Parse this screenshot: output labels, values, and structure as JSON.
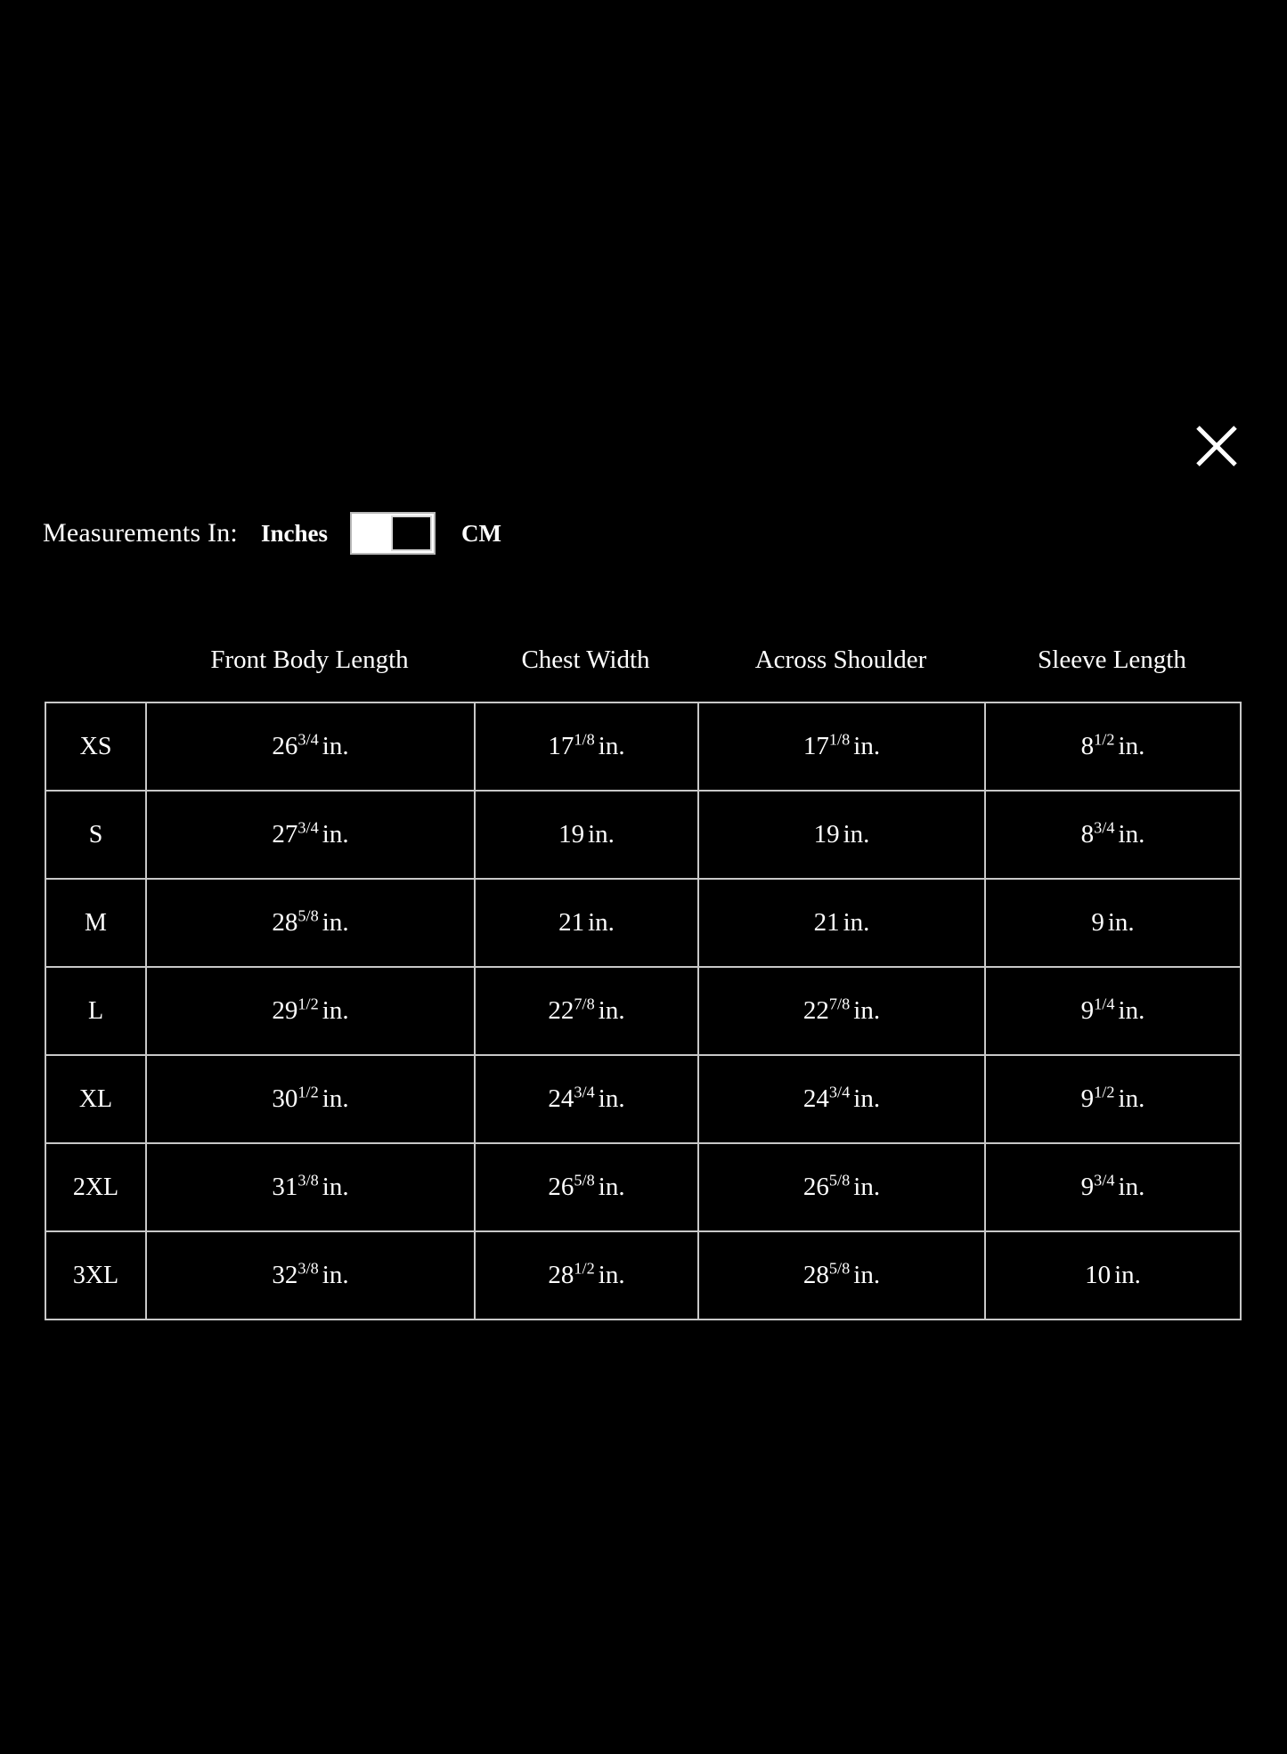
{
  "dialog": {
    "close_label": "Close",
    "close_icon": "close-x-icon"
  },
  "units": {
    "label": "Measurements In:",
    "option_left": "Inches",
    "option_right": "CM",
    "selected": "Inches",
    "toggle_state": "left",
    "track_color": "#ffffff",
    "knob_color": "#000000",
    "border_color": "#b9b9b9"
  },
  "table": {
    "size_column_header": "",
    "headers": [
      "Front Body Length",
      "Chest Width",
      "Across Shoulder",
      "Sleeve Length"
    ],
    "unit_suffix": "in.",
    "border_color": "#c8c8c8",
    "rows": [
      {
        "size": "XS",
        "cells": [
          {
            "whole": "26",
            "fraction": "3/4",
            "unit": "in."
          },
          {
            "whole": "17",
            "fraction": "1/8",
            "unit": "in."
          },
          {
            "whole": "17",
            "fraction": "1/8",
            "unit": "in."
          },
          {
            "whole": "8",
            "fraction": "1/2",
            "unit": "in."
          }
        ]
      },
      {
        "size": "S",
        "cells": [
          {
            "whole": "27",
            "fraction": "3/4",
            "unit": "in."
          },
          {
            "whole": "19",
            "fraction": "",
            "unit": "in."
          },
          {
            "whole": "19",
            "fraction": "",
            "unit": "in."
          },
          {
            "whole": "8",
            "fraction": "3/4",
            "unit": "in."
          }
        ]
      },
      {
        "size": "M",
        "cells": [
          {
            "whole": "28",
            "fraction": "5/8",
            "unit": "in."
          },
          {
            "whole": "21",
            "fraction": "",
            "unit": "in."
          },
          {
            "whole": "21",
            "fraction": "",
            "unit": "in."
          },
          {
            "whole": "9",
            "fraction": "",
            "unit": "in."
          }
        ]
      },
      {
        "size": "L",
        "cells": [
          {
            "whole": "29",
            "fraction": "1/2",
            "unit": "in."
          },
          {
            "whole": "22",
            "fraction": "7/8",
            "unit": "in."
          },
          {
            "whole": "22",
            "fraction": "7/8",
            "unit": "in."
          },
          {
            "whole": "9",
            "fraction": "1/4",
            "unit": "in."
          }
        ]
      },
      {
        "size": "XL",
        "cells": [
          {
            "whole": "30",
            "fraction": "1/2",
            "unit": "in."
          },
          {
            "whole": "24",
            "fraction": "3/4",
            "unit": "in."
          },
          {
            "whole": "24",
            "fraction": "3/4",
            "unit": "in."
          },
          {
            "whole": "9",
            "fraction": "1/2",
            "unit": "in."
          }
        ]
      },
      {
        "size": "2XL",
        "cells": [
          {
            "whole": "31",
            "fraction": "3/8",
            "unit": "in."
          },
          {
            "whole": "26",
            "fraction": "5/8",
            "unit": "in."
          },
          {
            "whole": "26",
            "fraction": "5/8",
            "unit": "in."
          },
          {
            "whole": "9",
            "fraction": "3/4",
            "unit": "in."
          }
        ]
      },
      {
        "size": "3XL",
        "cells": [
          {
            "whole": "32",
            "fraction": "3/8",
            "unit": "in."
          },
          {
            "whole": "28",
            "fraction": "1/2",
            "unit": "in."
          },
          {
            "whole": "28",
            "fraction": "5/8",
            "unit": "in."
          },
          {
            "whole": "10",
            "fraction": "",
            "unit": "in."
          }
        ]
      }
    ]
  }
}
